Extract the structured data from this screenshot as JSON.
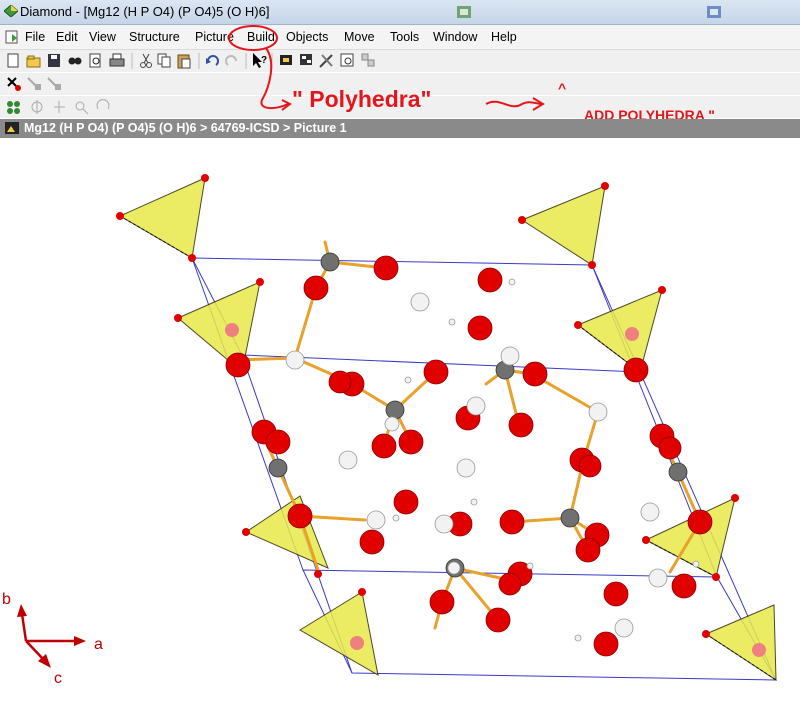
{
  "window": {
    "title": "Diamond - [Mg12 (H P O4) (P O4)5 (O H)6]"
  },
  "menu": {
    "items": [
      "File",
      "Edit",
      "View",
      "Structure",
      "Picture",
      "Build",
      "Objects",
      "Move",
      "Tools",
      "Window",
      "Help"
    ]
  },
  "annotations": {
    "polyhedra_label": "\" Polyhedra\"",
    "add_polyhedra_label": "ADD POLYHEDRA  \"",
    "caret": "^"
  },
  "document_path": "Mg12 (H P O4) (P O4)5 (O H)6 > 64769-ICSD > Picture 1",
  "axes": {
    "a": "a",
    "b": "b",
    "c": "c"
  },
  "colors": {
    "annotation": "#e3161c",
    "oxygen": "#e00000",
    "phosphorus": "#707070",
    "hydrogen": "#f2f2f2",
    "bond": "#e8a12a",
    "polyhedron": "#e8e84a",
    "cell": "#3b3bc8",
    "path_bar": "#8a8a8a"
  },
  "icons": [
    "diamond-app-icon",
    "new-icon",
    "open-icon",
    "save-icon",
    "find-icon",
    "print-preview-icon",
    "print-icon",
    "cut-icon",
    "copy-icon",
    "paste-icon",
    "undo-icon",
    "redo-icon",
    "help-pointer-icon",
    "polyhedra-icon",
    "atom-select-icon",
    "picture-icon"
  ]
}
